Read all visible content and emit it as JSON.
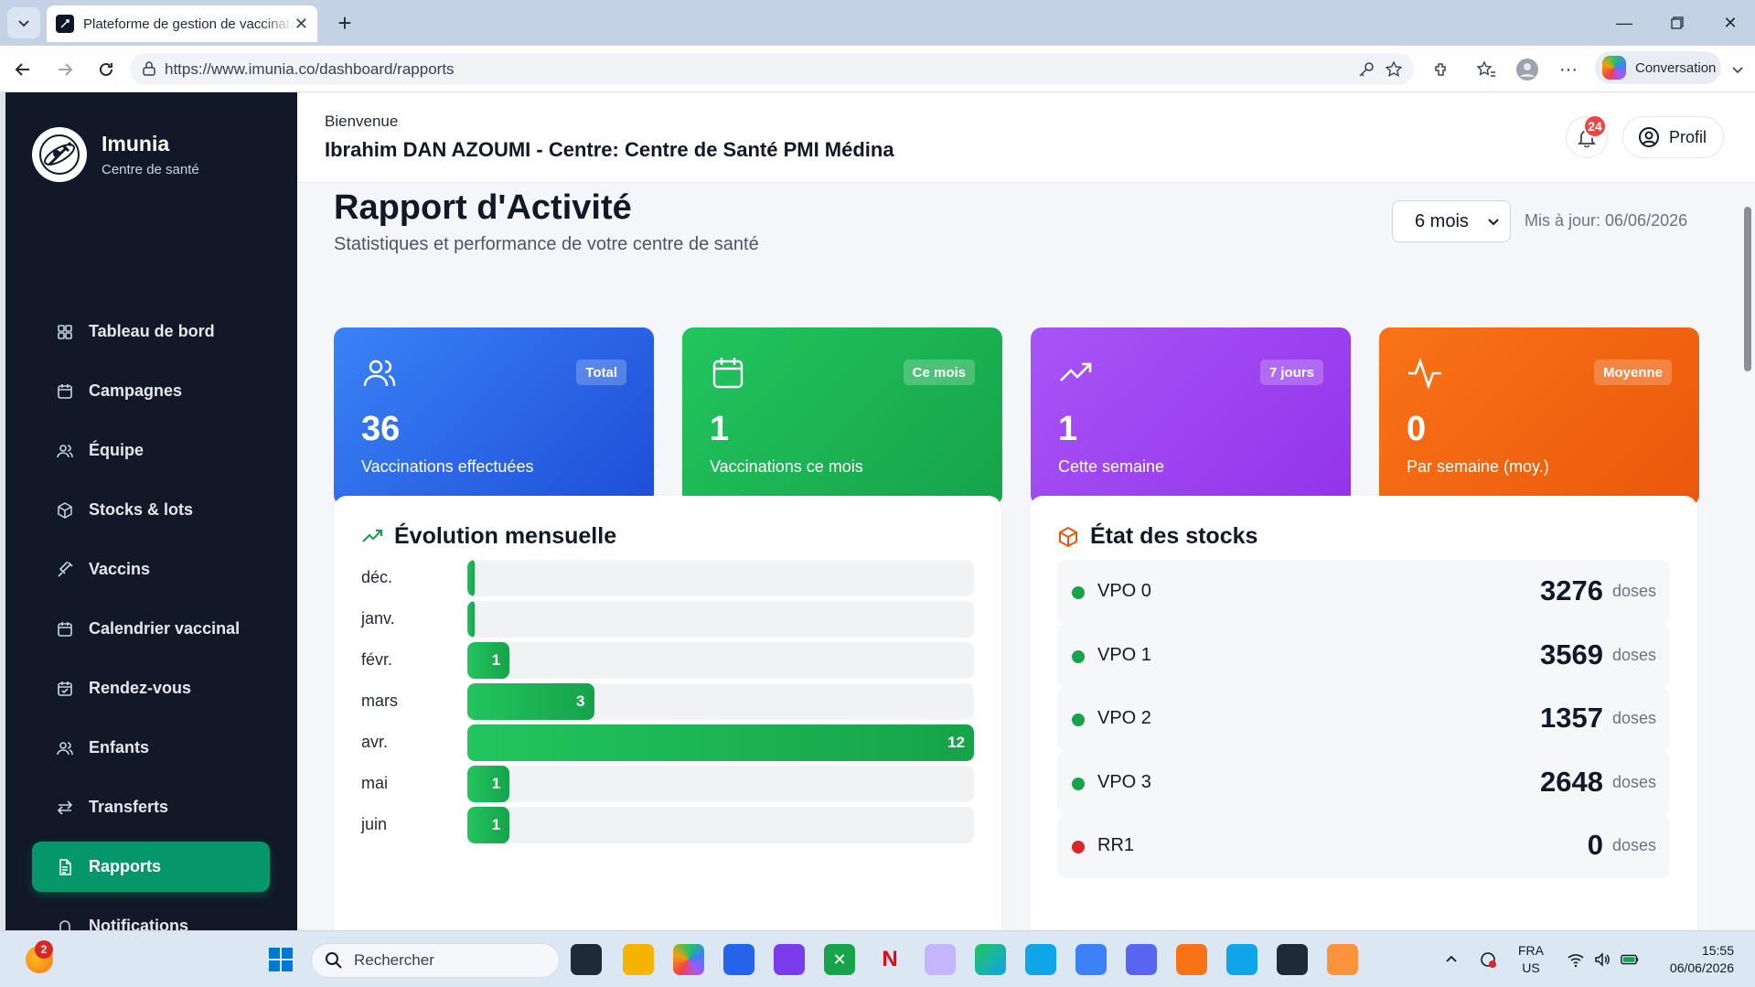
{
  "browser": {
    "tab_title": "Plateforme de gestion de vaccination",
    "url": "https://www.imunia.co/dashboard/rapports",
    "copilot_label": "Conversation"
  },
  "brand": {
    "name": "Imunia",
    "subtitle": "Centre de santé"
  },
  "nav": [
    {
      "label": "Tableau de bord",
      "icon": "grid-icon"
    },
    {
      "label": "Campagnes",
      "icon": "calendar-icon"
    },
    {
      "label": "Équipe",
      "icon": "users-icon"
    },
    {
      "label": "Stocks & lots",
      "icon": "package-icon"
    },
    {
      "label": "Vaccins",
      "icon": "syringe-icon"
    },
    {
      "label": "Calendrier vaccinal",
      "icon": "calendar-icon"
    },
    {
      "label": "Rendez-vous",
      "icon": "calendar-check-icon"
    },
    {
      "label": "Enfants",
      "icon": "users-icon"
    },
    {
      "label": "Transferts",
      "icon": "arrows-icon"
    },
    {
      "label": "Rapports",
      "icon": "file-text-icon",
      "active": true
    },
    {
      "label": "Notifications",
      "icon": "bell-icon"
    }
  ],
  "header": {
    "welcome": "Bienvenue",
    "user_line": "Ibrahim DAN AZOUMI - Centre: Centre de Santé PMI Médina",
    "notif_count": "24",
    "profile_label": "Profil"
  },
  "page": {
    "title": "Rapport d'Activité",
    "subtitle": "Statistiques et performance de votre centre de santé",
    "period": "6 mois",
    "updated": "Mis à jour: 06/06/2026"
  },
  "stats": [
    {
      "badge": "Total",
      "value": "36",
      "label": "Vaccinations effectuées",
      "icon": "users-icon",
      "color": "#2563eb"
    },
    {
      "badge": "Ce mois",
      "value": "1",
      "label": "Vaccinations ce mois",
      "icon": "calendar-icon",
      "color": "#16a34a"
    },
    {
      "badge": "7 jours",
      "value": "1",
      "label": "Cette semaine",
      "icon": "trending-up-icon",
      "color": "#9333ea"
    },
    {
      "badge": "Moyenne",
      "value": "0",
      "label": "Par semaine (moy.)",
      "icon": "activity-icon",
      "color": "#ea580c"
    }
  ],
  "evolution": {
    "title": "Évolution mensuelle",
    "max": 12,
    "months": [
      {
        "label": "déc.",
        "value": 0,
        "display": ""
      },
      {
        "label": "janv.",
        "value": 0,
        "display": ""
      },
      {
        "label": "févr.",
        "value": 1,
        "display": "1"
      },
      {
        "label": "mars",
        "value": 3,
        "display": "3"
      },
      {
        "label": "avr.",
        "value": 12,
        "display": "12"
      },
      {
        "label": "mai",
        "value": 1,
        "display": "1"
      },
      {
        "label": "juin",
        "value": 1,
        "display": "1"
      }
    ]
  },
  "stocks": {
    "title": "État des stocks",
    "items": [
      {
        "name": "VPO 0",
        "qty": "3276",
        "unit": "doses",
        "status_color": "#16a34a"
      },
      {
        "name": "VPO 1",
        "qty": "3569",
        "unit": "doses",
        "status_color": "#16a34a"
      },
      {
        "name": "VPO 2",
        "qty": "1357",
        "unit": "doses",
        "status_color": "#16a34a"
      },
      {
        "name": "VPO 3",
        "qty": "2648",
        "unit": "doses",
        "status_color": "#16a34a"
      },
      {
        "name": "RR1",
        "qty": "0",
        "unit": "doses",
        "status_color": "#dc2626"
      }
    ]
  },
  "taskbar": {
    "search_placeholder": "Rechercher",
    "weather_badge": "2",
    "lang_line1": "FRA",
    "lang_line2": "US",
    "time": "15:55",
    "date": "06/06/2026"
  }
}
